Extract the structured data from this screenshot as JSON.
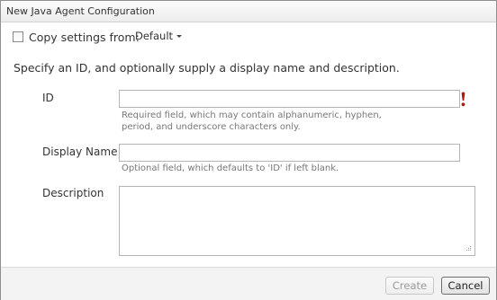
{
  "dialog": {
    "title": "New Java Agent Configuration"
  },
  "copy_settings": {
    "label": "Copy settings from:",
    "checked": false,
    "selected_option": "Default"
  },
  "instruction": "Specify an ID, and optionally supply a display name and description.",
  "fields": {
    "id": {
      "label": "ID",
      "value": "",
      "hint_line1": "Required field, which may contain alphanumeric, hyphen,",
      "hint_line2": "period, and underscore characters only."
    },
    "display_name": {
      "label": "Display Name",
      "value": "",
      "hint": "Optional field, which defaults to 'ID' if left blank."
    },
    "description": {
      "label": "Description",
      "value": ""
    }
  },
  "buttons": {
    "create_label": "Create",
    "cancel_label": "Cancel"
  },
  "icons": {
    "required": "required-exclamation-icon",
    "resize": "resize-grip-icon",
    "dropdown": "chevron-down-icon"
  },
  "colors": {
    "required_marker": "#b01818"
  }
}
